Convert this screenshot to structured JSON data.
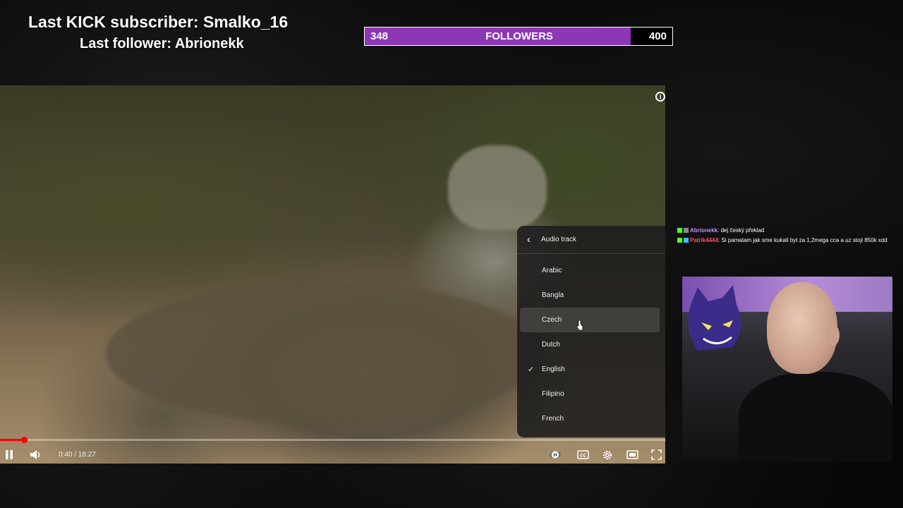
{
  "overlay": {
    "subscriber_text": "Last KICK subscriber: Smalko_16",
    "follower_text": "Last follower: Abrionekk",
    "follower_goal": {
      "start": "348",
      "label": "FOLLOWERS",
      "end": "400",
      "fill_fraction": 0.864,
      "fill_color": "#8c37b5"
    }
  },
  "player": {
    "settings_menu": {
      "title": "Audio track",
      "items": [
        {
          "label": "Arabic",
          "selected": false
        },
        {
          "label": "Bangla",
          "selected": false
        },
        {
          "label": "Czech",
          "selected": false,
          "hovered": true
        },
        {
          "label": "Dutch",
          "selected": false
        },
        {
          "label": "English",
          "selected": true
        },
        {
          "label": "Filipino",
          "selected": false
        },
        {
          "label": "French",
          "selected": false
        }
      ]
    },
    "time": "0:40 / 18:27",
    "progress_fraction": 0.036,
    "accent_color": "#ff0000",
    "icons": [
      "pause-icon",
      "volume-icon",
      "autoplay-icon",
      "subtitles-icon",
      "settings-icon",
      "theater-icon",
      "fullscreen-icon",
      "info-icon"
    ]
  },
  "chat": {
    "messages": [
      {
        "user": "Abrionekk",
        "user_color": "#c78bff",
        "text": ": dej český překlad"
      },
      {
        "user": "Patrik4444",
        "user_color": "#ff4d6d",
        "text": ": Si pamatam jak sme kukali byt za 1,2mega cca a uz stoji 850k xdd"
      }
    ]
  }
}
